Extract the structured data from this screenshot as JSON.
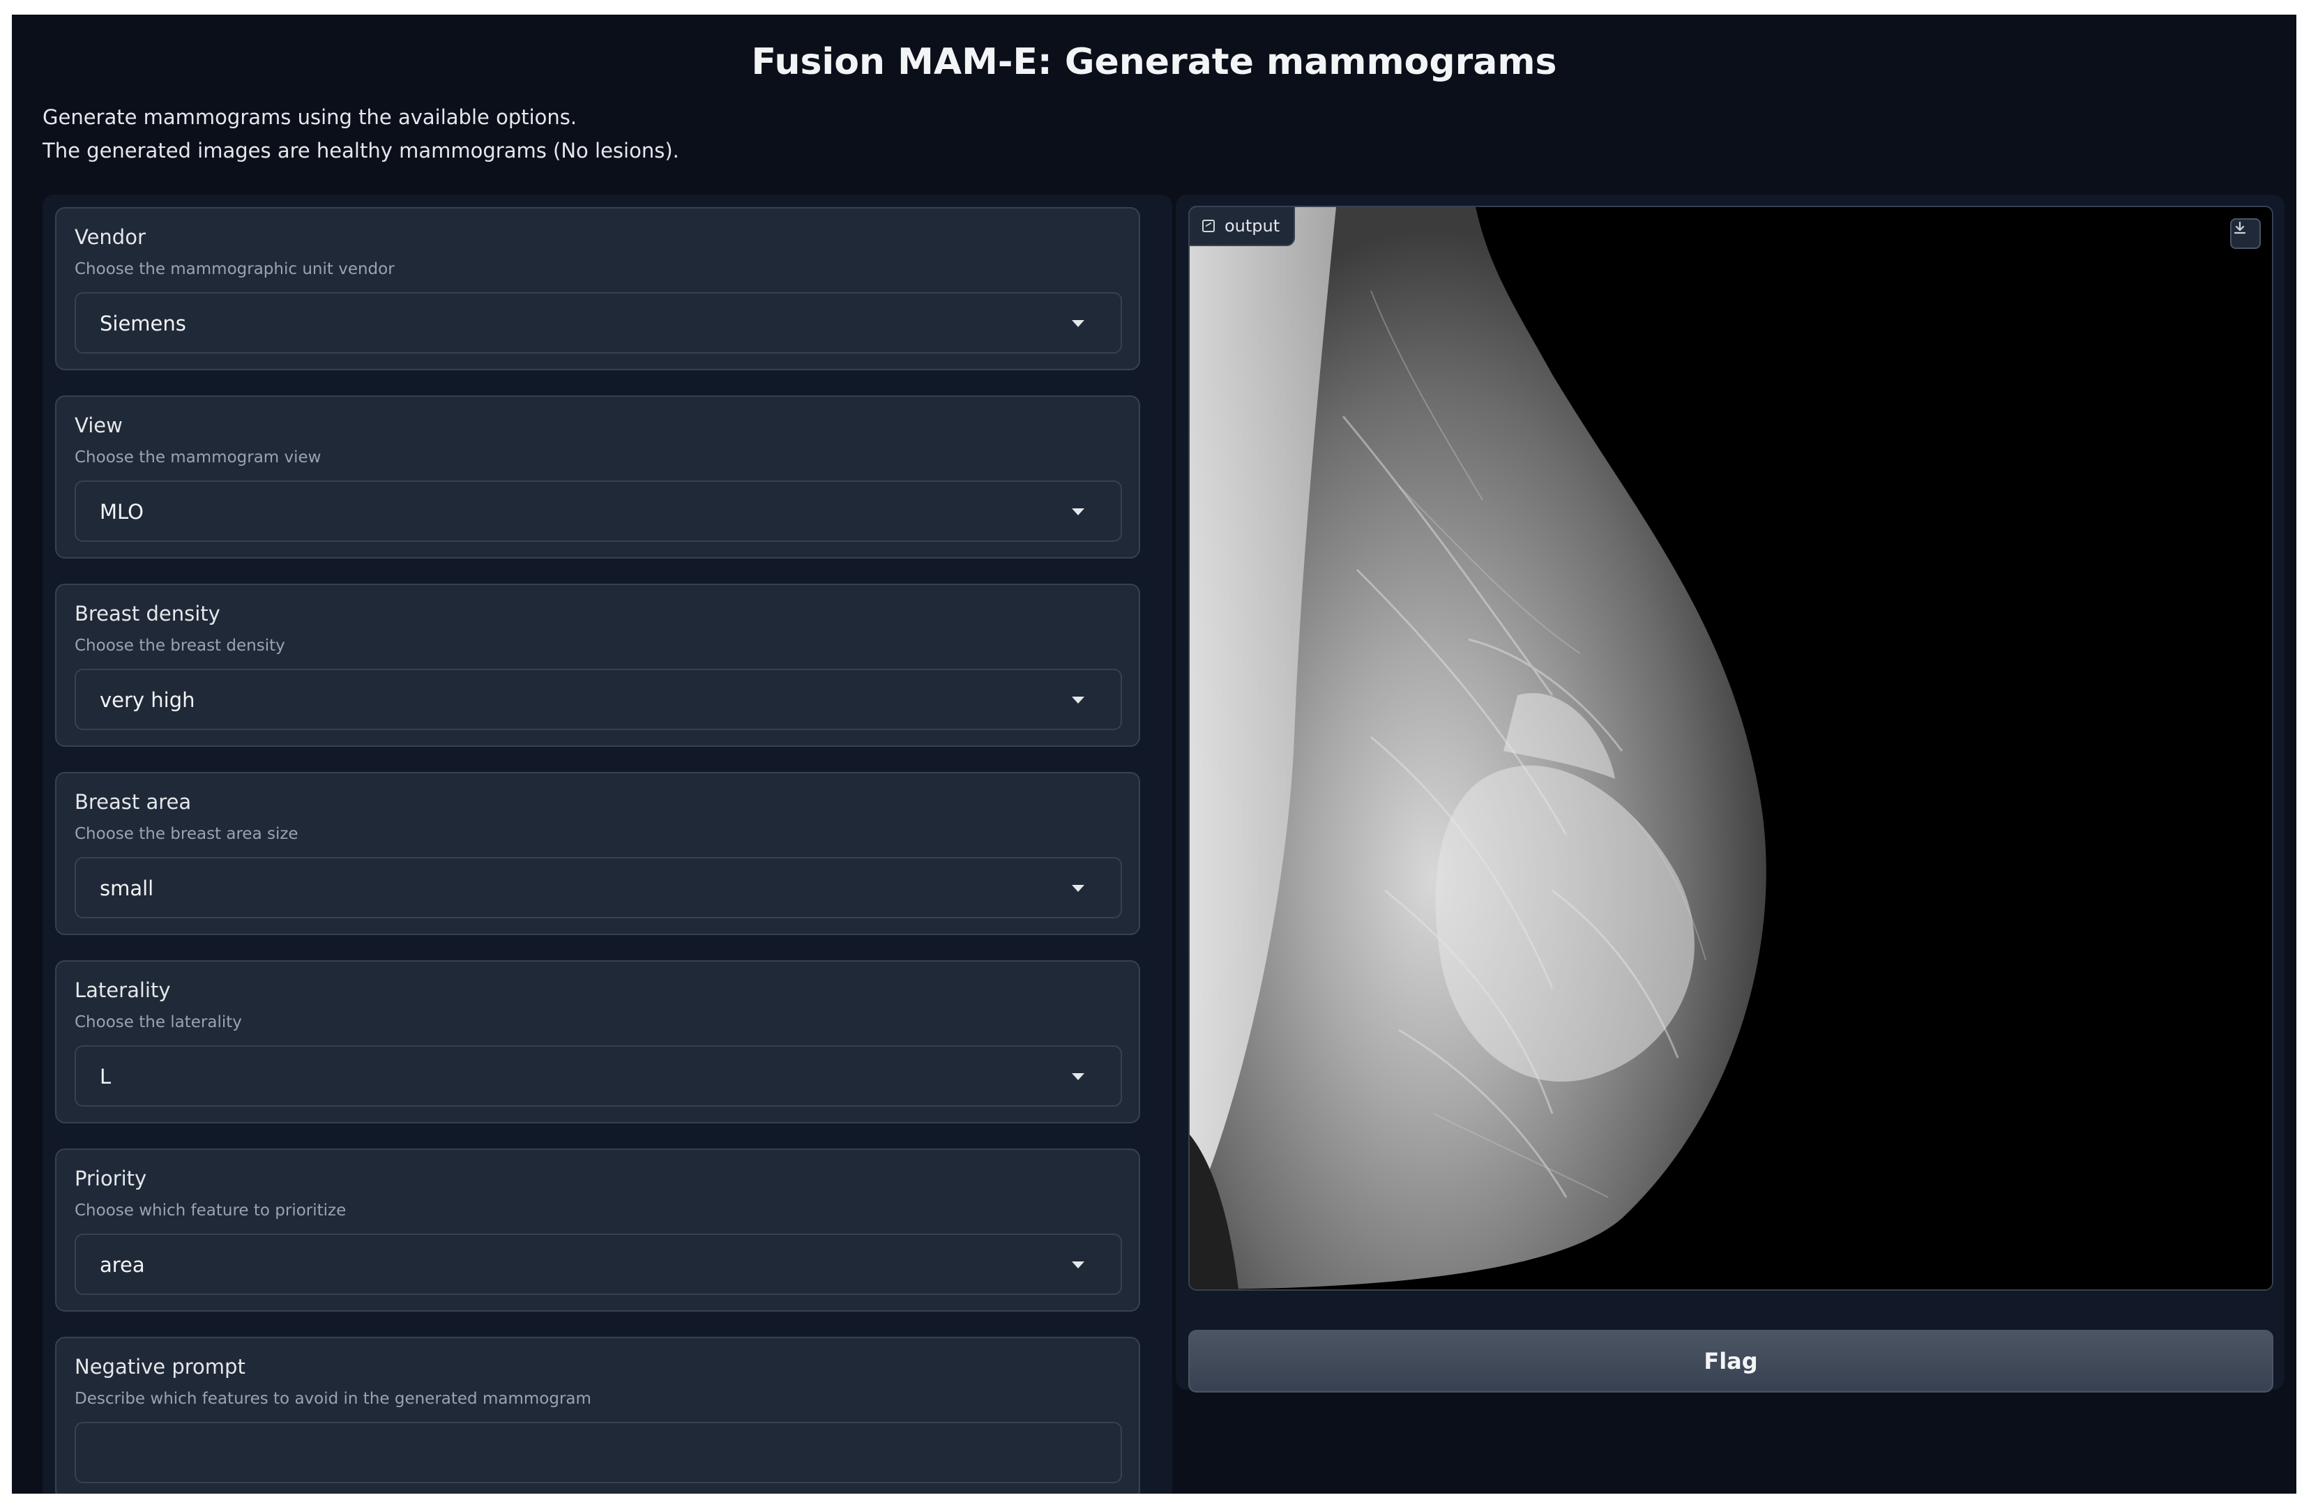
{
  "page": {
    "title": "Fusion MAM-E: Generate mammograms",
    "description_line1": "Generate mammograms using the available options.",
    "description_line2": "The generated images are healthy mammograms (No lesions)."
  },
  "controls": [
    {
      "label": "Vendor",
      "info": "Choose the mammographic unit vendor",
      "value": "Siemens"
    },
    {
      "label": "View",
      "info": "Choose the mammogram view",
      "value": "MLO"
    },
    {
      "label": "Breast density",
      "info": "Choose the breast density",
      "value": "very high"
    },
    {
      "label": "Breast area",
      "info": "Choose the breast area size",
      "value": "small"
    },
    {
      "label": "Laterality",
      "info": "Choose the laterality",
      "value": "L"
    },
    {
      "label": "Priority",
      "info": "Choose which feature to prioritize",
      "value": "area"
    }
  ],
  "negative_prompt": {
    "label": "Negative prompt",
    "info": "Describe which features to avoid in the generated mammogram",
    "value": "",
    "placeholder": ""
  },
  "output": {
    "label": "output",
    "icon": "image-icon",
    "download_icon": "download-icon"
  },
  "flag_button": "Flag",
  "colors": {
    "background": "#0b0f19",
    "panel": "#111827",
    "block": "#1f2937",
    "border": "#374151",
    "button": "#4b5563"
  }
}
